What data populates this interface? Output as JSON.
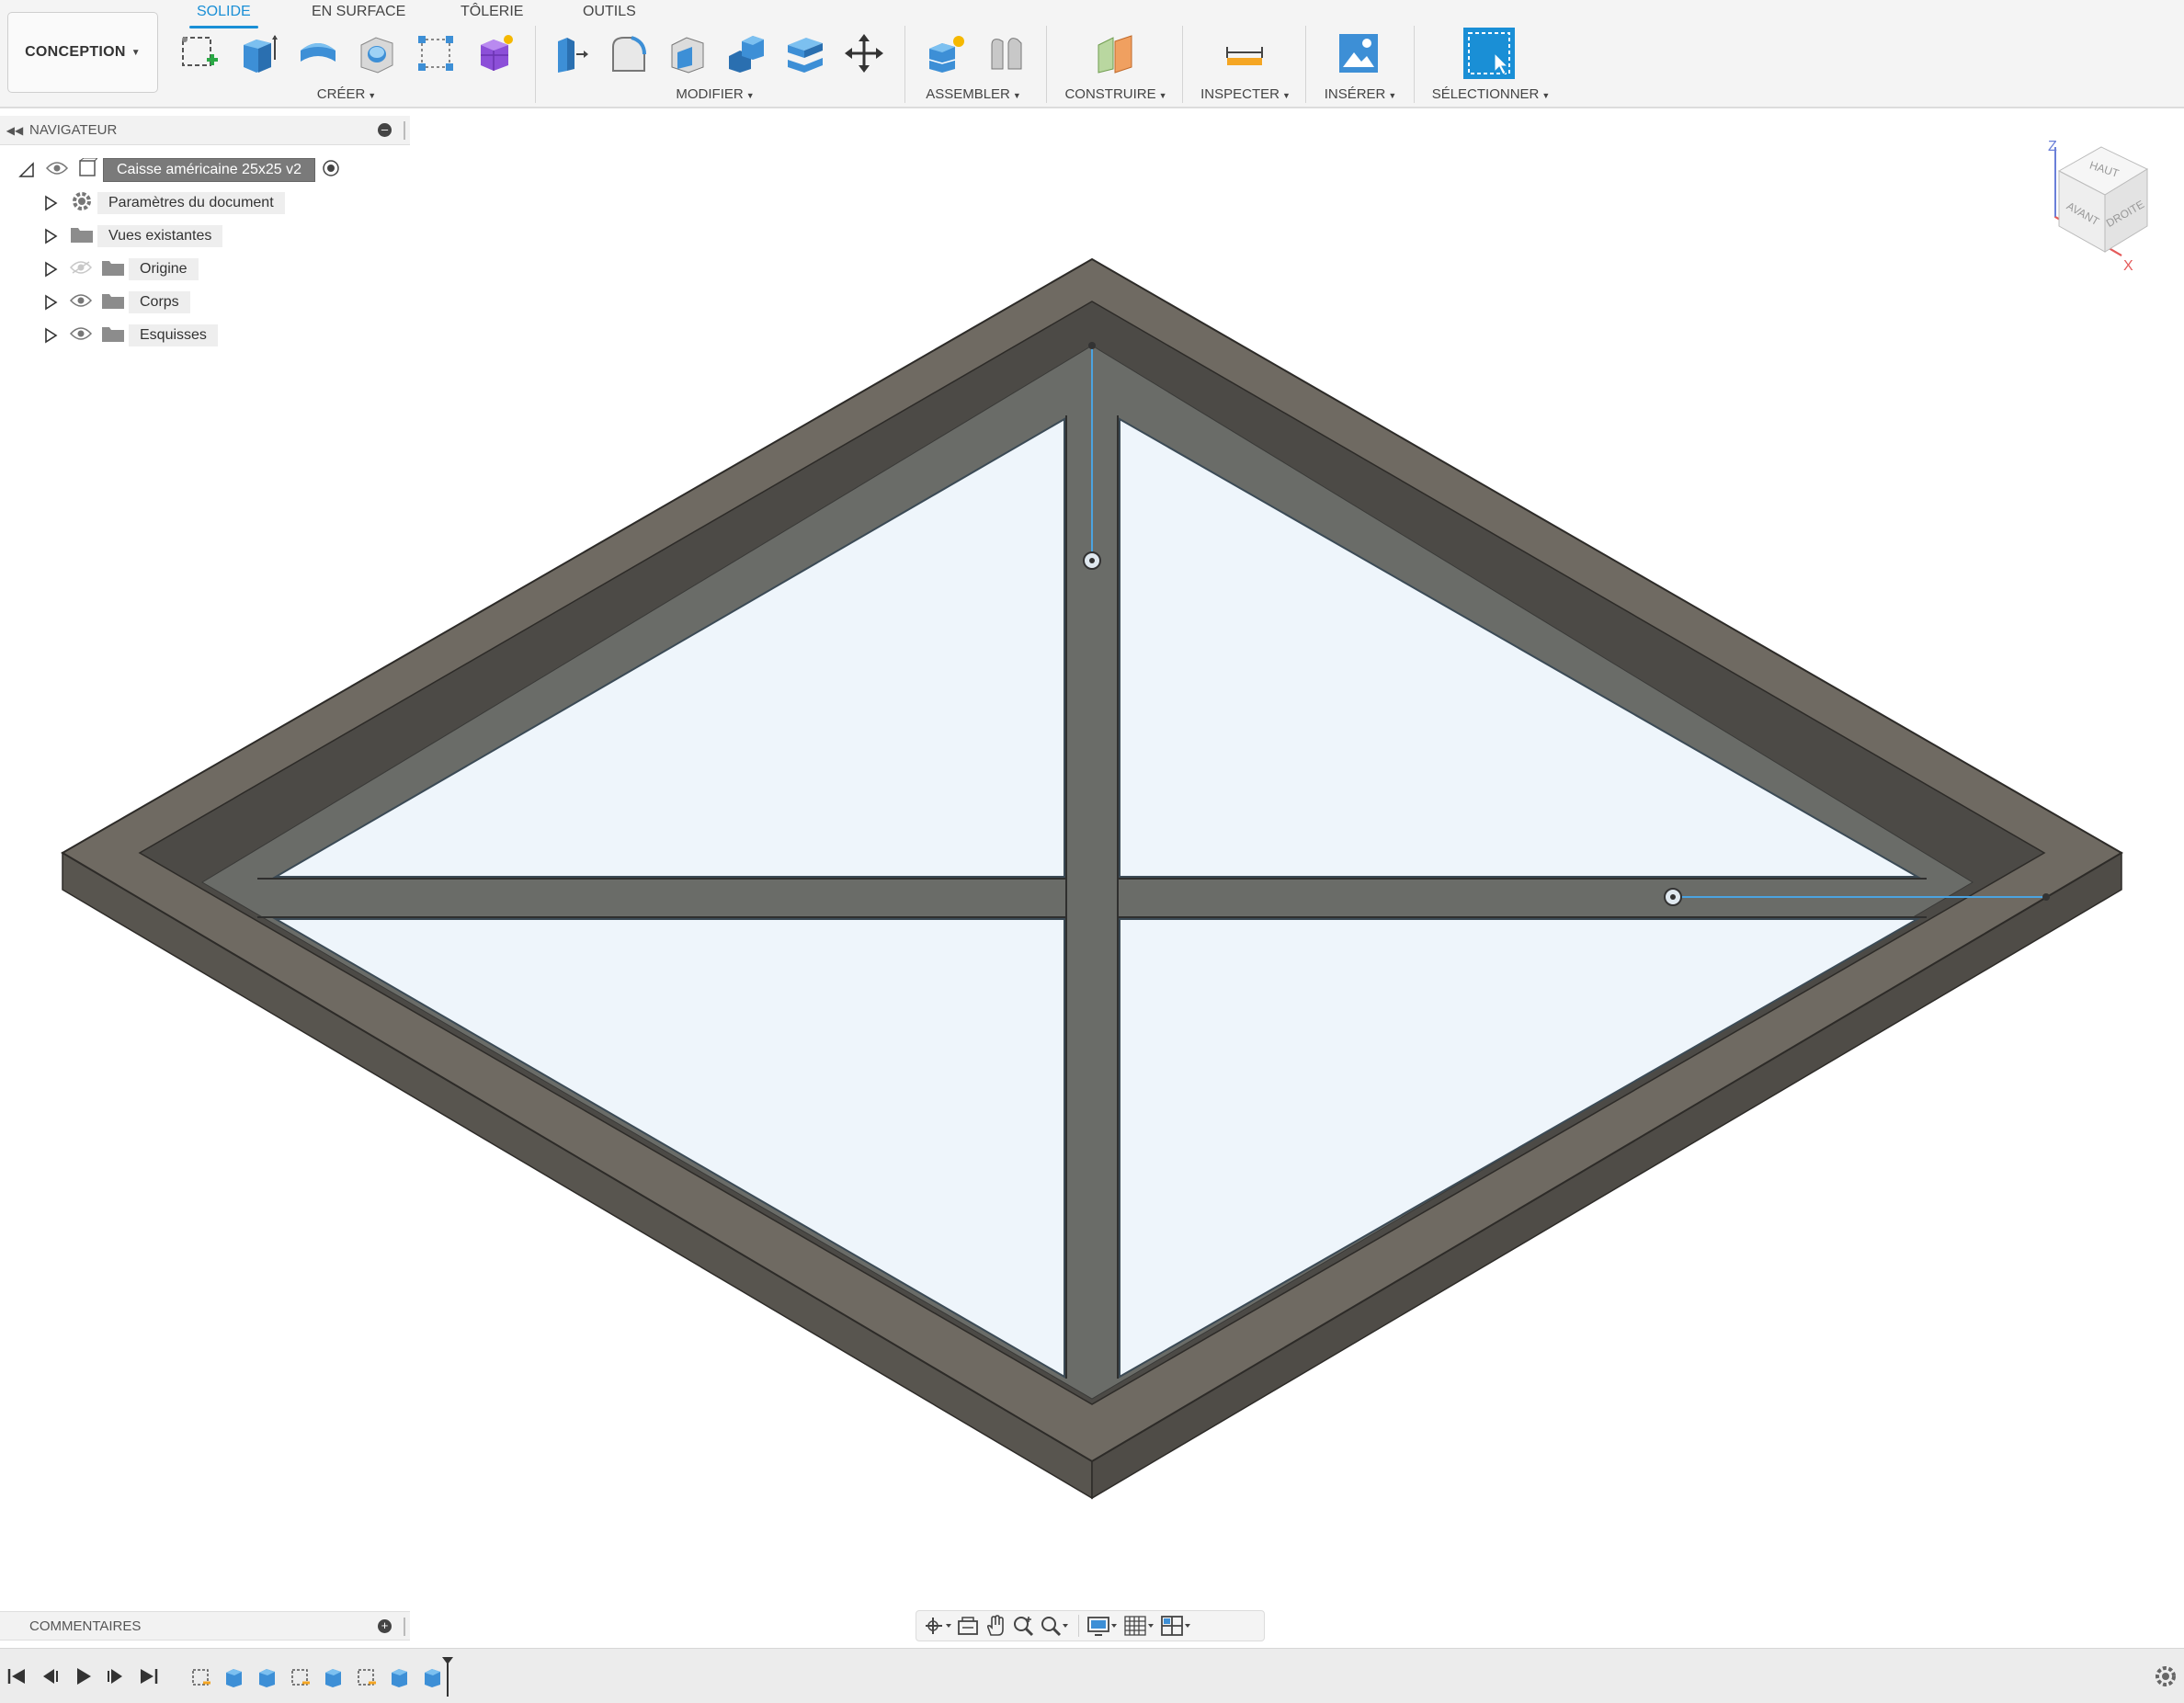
{
  "workspace": {
    "label": "CONCEPTION"
  },
  "tabs": [
    {
      "label": "SOLIDE",
      "active": true
    },
    {
      "label": "EN SURFACE",
      "active": false
    },
    {
      "label": "TÔLERIE",
      "active": false
    },
    {
      "label": "OUTILS",
      "active": false
    }
  ],
  "toolbar_groups": [
    {
      "label": "CRÉER"
    },
    {
      "label": "MODIFIER"
    },
    {
      "label": "ASSEMBLER"
    },
    {
      "label": "CONSTRUIRE"
    },
    {
      "label": "INSPECTER"
    },
    {
      "label": "INSÉRER"
    },
    {
      "label": "SÉLECTIONNER"
    }
  ],
  "navigator": {
    "title": "NAVIGATEUR",
    "root": {
      "label": "Caisse américaine 25x25 v2"
    },
    "items": [
      {
        "label": "Paramètres du document",
        "icon": "gear-icon"
      },
      {
        "label": "Vues existantes",
        "icon": "folder-icon"
      },
      {
        "label": "Origine",
        "icon": "folder-icon",
        "visible": false
      },
      {
        "label": "Corps",
        "icon": "folder-icon",
        "visible": true
      },
      {
        "label": "Esquisses",
        "icon": "folder-icon",
        "visible": true
      }
    ]
  },
  "viewcube": {
    "top": "HAUT",
    "front": "AVANT",
    "right": "DROITE",
    "axis_z": "Z",
    "axis_x": "X"
  },
  "comments": {
    "title": "COMMENTAIRES"
  },
  "colors": {
    "accent": "#1a8fd6",
    "frame_top": "#6f6a62",
    "frame_side": "#58554f",
    "glass": "#eef5fb"
  }
}
